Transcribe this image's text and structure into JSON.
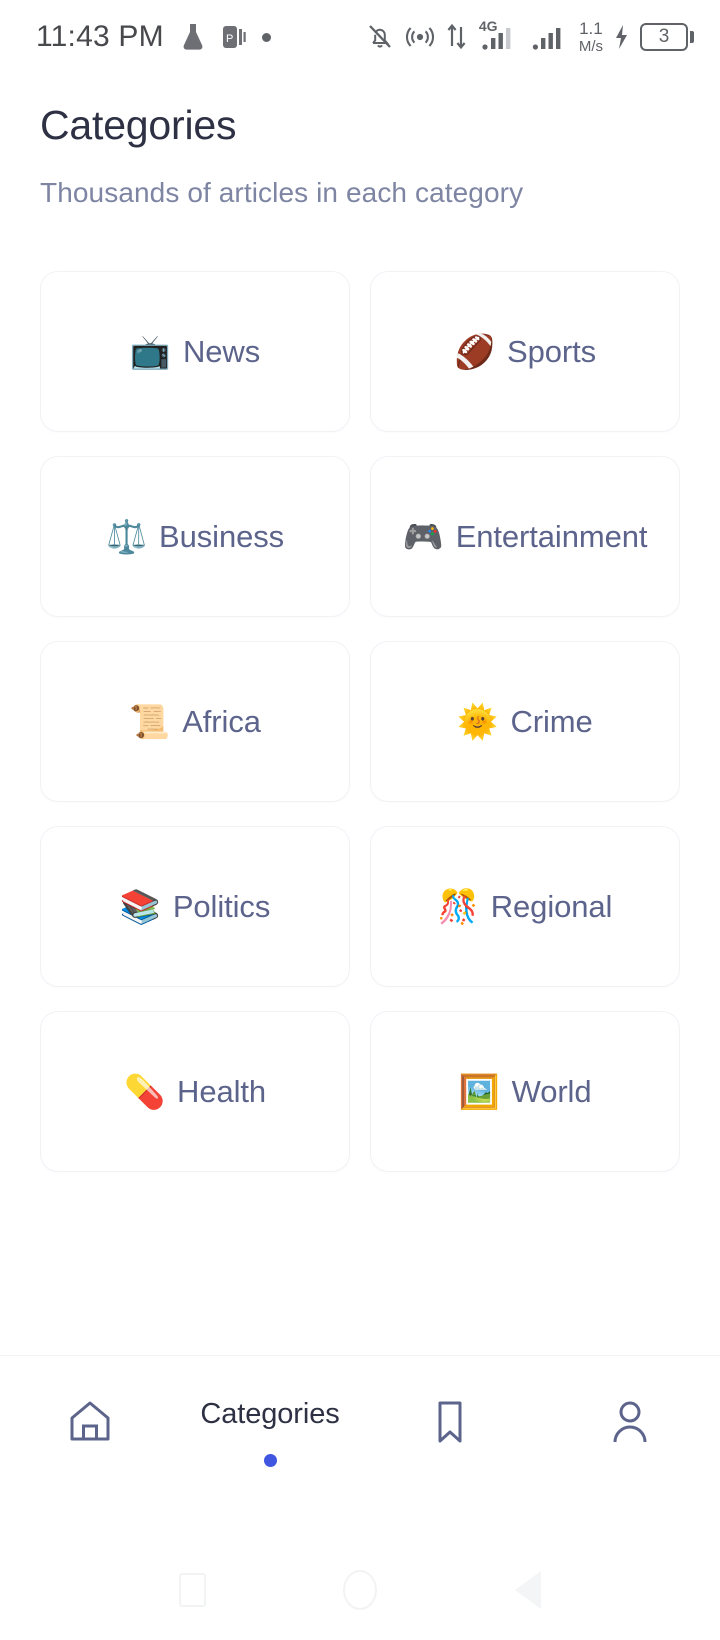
{
  "status_bar": {
    "time": "11:43 PM",
    "left_icons": [
      "flask-icon",
      "app-badge-icon",
      "dot-indicator-icon"
    ],
    "right_icons": [
      "bell-off-icon",
      "hotspot-icon",
      "data-transfer-icon",
      "signal-4g-icon",
      "signal-bars-icon",
      "charging-bolt-icon"
    ],
    "network_type": "4G",
    "net_speed_value": "1.1",
    "net_speed_unit": "M/s",
    "battery_level": "3"
  },
  "header": {
    "title": "Categories",
    "subtitle": "Thousands of articles in each category"
  },
  "categories": [
    {
      "emoji": "📺",
      "icon_name": "television-emoji",
      "label": "News"
    },
    {
      "emoji": "🏈",
      "icon_name": "football-emoji",
      "label": "Sports"
    },
    {
      "emoji": "⚖️",
      "icon_name": "balance-scale-emoji",
      "label": "Business"
    },
    {
      "emoji": "🎮",
      "icon_name": "video-game-controller-emoji",
      "label": "Entertainment"
    },
    {
      "emoji": "📜",
      "icon_name": "scroll-emoji",
      "label": "Africa"
    },
    {
      "emoji": "🌞",
      "icon_name": "sun-with-face-emoji",
      "label": "Crime"
    },
    {
      "emoji": "📚",
      "icon_name": "books-emoji",
      "label": "Politics"
    },
    {
      "emoji": "🎊",
      "icon_name": "confetti-ball-emoji",
      "label": "Regional"
    },
    {
      "emoji": "💊",
      "icon_name": "pill-emoji",
      "label": "Health"
    },
    {
      "emoji": "🖼️",
      "icon_name": "framed-picture-emoji",
      "label": "World"
    }
  ],
  "bottom_nav": {
    "items": [
      {
        "icon_name": "home-icon",
        "label": "",
        "active": false
      },
      {
        "icon_name": "grid-icon",
        "label": "Categories",
        "active": true
      },
      {
        "icon_name": "bookmark-icon",
        "label": "",
        "active": false
      },
      {
        "icon_name": "person-icon",
        "label": "",
        "active": false
      }
    ],
    "active_label": "Categories"
  },
  "android_nav": {
    "recents": "square-recents-icon",
    "home": "circle-home-icon",
    "back": "triangle-back-icon"
  },
  "colors": {
    "title": "#2e3144",
    "subtitle": "#7d85a3",
    "card_label": "#5d648c",
    "card_border": "#f1f2f6",
    "accent_dot": "#4055e0",
    "status_icon": "#5f6368",
    "background": "#ffffff"
  }
}
